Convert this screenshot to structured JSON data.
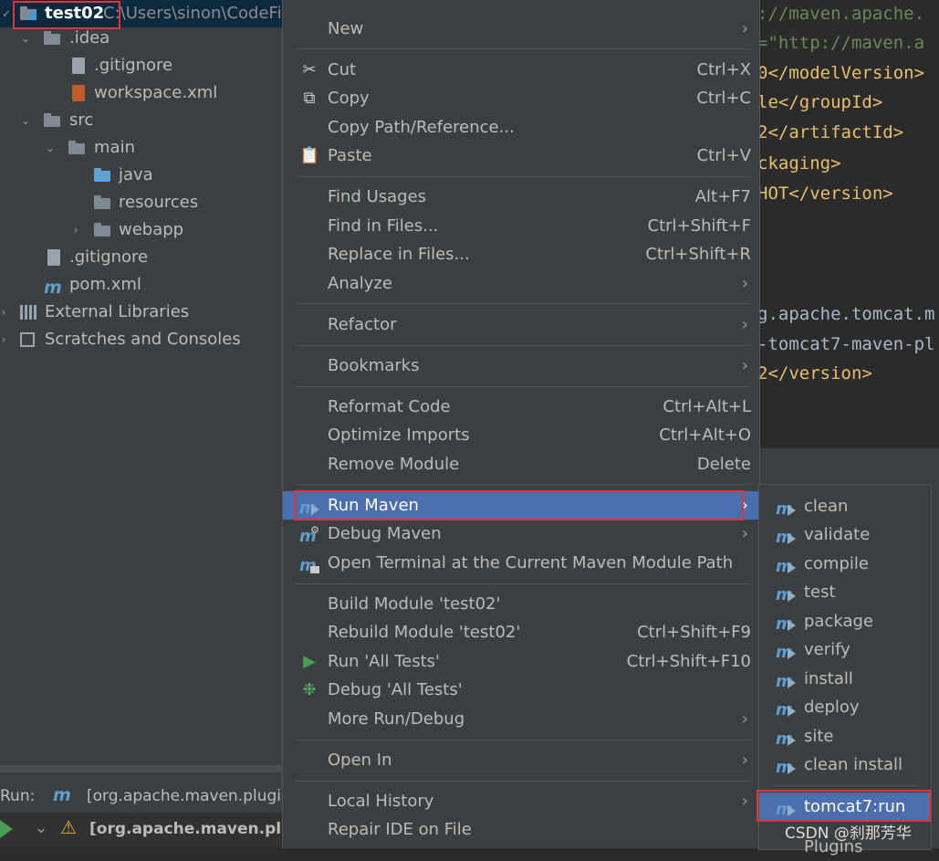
{
  "project_tree": {
    "root": {
      "name": "test02",
      "path": "C:\\Users\\sinon\\CodeFile\\JavaCode\\IDEA\\..."
    },
    "items": [
      {
        "label": ".idea",
        "kind": "folder"
      },
      {
        "label": ".gitignore",
        "kind": "file"
      },
      {
        "label": "workspace.xml",
        "kind": "xml"
      },
      {
        "label": "src",
        "kind": "folder"
      },
      {
        "label": "main",
        "kind": "folder"
      },
      {
        "label": "java",
        "kind": "source-folder"
      },
      {
        "label": "resources",
        "kind": "resource-folder"
      },
      {
        "label": "webapp",
        "kind": "web-folder"
      },
      {
        "label": ".gitignore",
        "kind": "file"
      },
      {
        "label": "pom.xml",
        "kind": "maven"
      },
      {
        "label": "External Libraries",
        "kind": "libraries"
      },
      {
        "label": "Scratches and Consoles",
        "kind": "scratches"
      }
    ]
  },
  "run_panel": {
    "label": "Run:",
    "tab": "[org.apache.maven.plugi",
    "task": "[org.apache.maven.plug"
  },
  "editor": {
    "lines": [
      "://maven.apache.",
      "=\"http://maven.a",
      "0</modelVersion>",
      "le</groupId>",
      "2</artifactId>",
      "ckaging>",
      "HOT</version>",
      "g.apache.tomcat.m",
      "-tomcat7-maven-pl",
      "2</version>"
    ]
  },
  "context_menu": {
    "items": [
      {
        "label": "New",
        "shortcut": "",
        "submenu": true
      },
      {
        "label": "Cut",
        "shortcut": "Ctrl+X",
        "submenu": false,
        "icon": "scissors-icon"
      },
      {
        "label": "Copy",
        "shortcut": "Ctrl+C",
        "submenu": false,
        "icon": "copy-icon"
      },
      {
        "label": "Copy Path/Reference...",
        "shortcut": "",
        "submenu": false
      },
      {
        "label": "Paste",
        "shortcut": "Ctrl+V",
        "submenu": false,
        "icon": "clipboard-icon"
      },
      {
        "label": "Find Usages",
        "shortcut": "Alt+F7",
        "submenu": false
      },
      {
        "label": "Find in Files...",
        "shortcut": "Ctrl+Shift+F",
        "submenu": false
      },
      {
        "label": "Replace in Files...",
        "shortcut": "Ctrl+Shift+R",
        "submenu": false
      },
      {
        "label": "Analyze",
        "shortcut": "",
        "submenu": true
      },
      {
        "label": "Refactor",
        "shortcut": "",
        "submenu": true
      },
      {
        "label": "Bookmarks",
        "shortcut": "",
        "submenu": true
      },
      {
        "label": "Reformat Code",
        "shortcut": "Ctrl+Alt+L",
        "submenu": false
      },
      {
        "label": "Optimize Imports",
        "shortcut": "Ctrl+Alt+O",
        "submenu": false
      },
      {
        "label": "Remove Module",
        "shortcut": "Delete",
        "submenu": false
      },
      {
        "label": "Run Maven",
        "shortcut": "",
        "submenu": true,
        "selected": true,
        "icon": "maven-run-icon"
      },
      {
        "label": "Debug Maven",
        "shortcut": "",
        "submenu": true,
        "icon": "maven-debug-icon"
      },
      {
        "label": "Open Terminal at the Current Maven Module Path",
        "shortcut": "",
        "submenu": false,
        "icon": "terminal-icon"
      },
      {
        "label": "Build Module 'test02'",
        "shortcut": "",
        "submenu": false
      },
      {
        "label": "Rebuild Module 'test02'",
        "shortcut": "Ctrl+Shift+F9",
        "submenu": false
      },
      {
        "label": "Run 'All Tests'",
        "shortcut": "Ctrl+Shift+F10",
        "submenu": false,
        "icon": "run-icon"
      },
      {
        "label": "Debug 'All Tests'",
        "shortcut": "",
        "submenu": false,
        "icon": "debug-bug-icon"
      },
      {
        "label": "More Run/Debug",
        "shortcut": "",
        "submenu": true
      },
      {
        "label": "Open In",
        "shortcut": "",
        "submenu": true
      },
      {
        "label": "Local History",
        "shortcut": "",
        "submenu": true
      },
      {
        "label": "Repair IDE on File",
        "shortcut": "",
        "submenu": false
      }
    ]
  },
  "maven_submenu": {
    "items": [
      "clean",
      "validate",
      "compile",
      "test",
      "package",
      "verify",
      "install",
      "deploy",
      "site",
      "clean install",
      "tomcat7:run",
      "Plugins"
    ],
    "selected": "tomcat7:run"
  },
  "watermark": "CSDN @刹那芳华",
  "colors": {
    "selection": "#4b6eaf",
    "highlight_box": "#e0353d",
    "menu_bg": "#3c3f41"
  }
}
